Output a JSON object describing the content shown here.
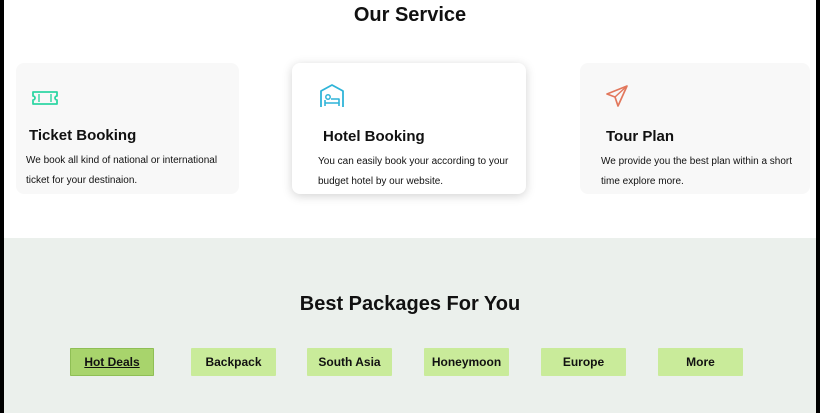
{
  "services": {
    "title": "Our Service",
    "cards": [
      {
        "icon": "ticket-icon",
        "title": "Ticket Booking",
        "desc_line1": "We book all kind of national or international",
        "desc_line2": "ticket for your destinaion."
      },
      {
        "icon": "hotel-bed-icon",
        "title": "Hotel Booking",
        "desc_line1": "You can easily book your according to your",
        "desc_line2": "budget hotel by our website."
      },
      {
        "icon": "paper-plane-icon",
        "title": "Tour Plan",
        "desc_line1": "We provide you the best plan within a short",
        "desc_line2": "time explore more."
      }
    ]
  },
  "packages": {
    "title": "Best Packages For You",
    "tabs": [
      "Hot Deals",
      "Backpack",
      "South Asia",
      "Honeymoon",
      "Europe",
      "More"
    ],
    "active_tab": "Hot Deals"
  },
  "colors": {
    "ticket_icon": "#2ed6a3",
    "hotel_icon": "#2fb4d8",
    "plane_icon": "#e2775c",
    "tab_bg": "#c9eb9a",
    "tab_active_bg": "#a8d46c",
    "packages_bg": "#ebf0ec"
  }
}
